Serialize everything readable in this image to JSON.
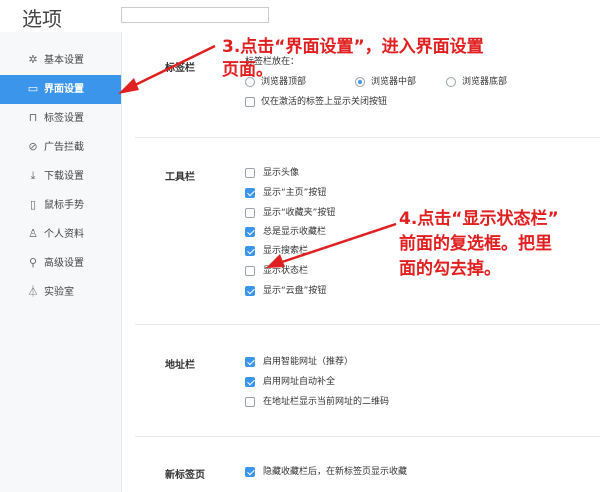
{
  "window": {
    "title": "选项",
    "search_value": ""
  },
  "sidebar": {
    "items": [
      {
        "label": "基本设置",
        "icon": "gear-icon",
        "active": false
      },
      {
        "label": "界面设置",
        "icon": "window-icon",
        "active": true
      },
      {
        "label": "标签设置",
        "icon": "tab-icon",
        "active": false
      },
      {
        "label": "广告拦截",
        "icon": "block-icon",
        "active": false
      },
      {
        "label": "下载设置",
        "icon": "download-icon",
        "active": false
      },
      {
        "label": "鼠标手势",
        "icon": "mouse-icon",
        "active": false
      },
      {
        "label": "个人资料",
        "icon": "user-icon",
        "active": false
      },
      {
        "label": "高级设置",
        "icon": "wrench-icon",
        "active": false
      },
      {
        "label": "实验室",
        "icon": "flask-icon",
        "active": false
      }
    ]
  },
  "tabs_section": {
    "title": "标签栏",
    "position_label": "标签栏放在：",
    "positions": [
      {
        "label": "浏览器顶部",
        "checked": false
      },
      {
        "label": "浏览器中部",
        "checked": true
      },
      {
        "label": "浏览器底部",
        "checked": false
      }
    ],
    "close_only_active": {
      "label": "仅在激活的标签上显示关闭按钮",
      "checked": false
    }
  },
  "toolbar_section": {
    "title": "工具栏",
    "options": [
      {
        "label": "显示头像",
        "checked": false
      },
      {
        "label": "显示“主页”按钮",
        "checked": true
      },
      {
        "label": "显示“收藏夹”按钮",
        "checked": false
      },
      {
        "label": "总是显示收藏栏",
        "checked": true
      },
      {
        "label": "显示搜索栏",
        "checked": true
      },
      {
        "label": "显示状态栏",
        "checked": false
      },
      {
        "label": "显示“云盘”按钮",
        "checked": true
      }
    ]
  },
  "address_section": {
    "title": "地址栏",
    "options": [
      {
        "label": "启用智能网址（推荐）",
        "checked": true
      },
      {
        "label": "启用网址自动补全",
        "checked": true
      },
      {
        "label": "在地址栏显示当前网址的二维码",
        "checked": false
      }
    ]
  },
  "newtab_section": {
    "title": "新标签页",
    "options": [
      {
        "label": "隐藏收藏栏后，在新标签页显示收藏",
        "checked": true
      }
    ]
  },
  "annotations": {
    "step3_line1": "3.点击“界面设置”，进入界面设置",
    "step3_line2": "页面。",
    "step4_line1": "4.点击“显示状态栏”",
    "step4_line2": "前面的复选框。把里",
    "step4_line3": "面的勾去掉。",
    "color": "#e02020"
  },
  "colors": {
    "accent": "#3b95ea",
    "sidebar_bg": "#f6f8fa"
  }
}
